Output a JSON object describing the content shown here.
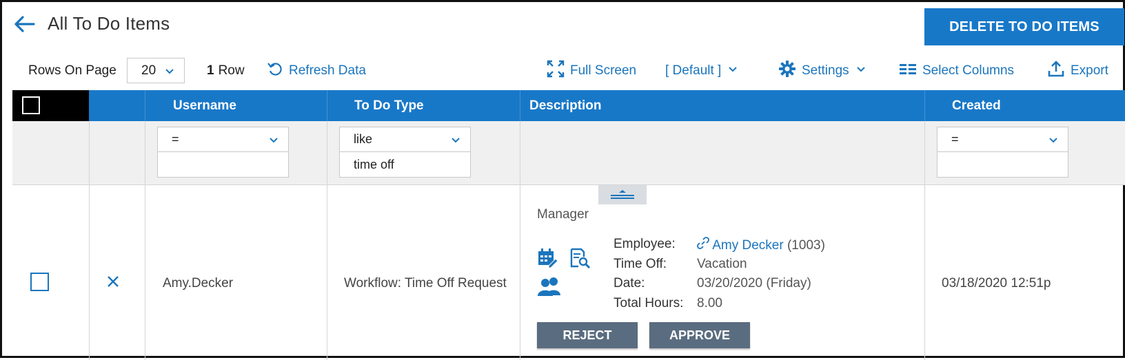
{
  "header": {
    "title": "All To Do Items",
    "delete_button": "DELETE TO DO ITEMS"
  },
  "toolbar": {
    "rows_on_page_label": "Rows On Page",
    "rows_on_page_value": "20",
    "row_count": "1",
    "row_count_label": "Row",
    "refresh_label": "Refresh Data",
    "full_screen_label": "Full Screen",
    "view_label": "[ Default ]",
    "settings_label": "Settings",
    "select_columns_label": "Select Columns",
    "export_label": "Export"
  },
  "table": {
    "columns": {
      "username": "Username",
      "todo_type": "To Do Type",
      "description": "Description",
      "created": "Created"
    },
    "filters": {
      "username_operator": "=",
      "username_value": "",
      "todo_type_operator": "like",
      "todo_type_value": "time off",
      "created_operator": "=",
      "created_value": ""
    },
    "rows": [
      {
        "username": "Amy.Decker",
        "todo_type": "Workflow: Time Off Request",
        "description": {
          "role": "Manager",
          "employee_label": "Employee:",
          "employee_name": "Amy Decker",
          "employee_id": "(1003)",
          "time_off_label": "Time Off:",
          "time_off_value": "Vacation",
          "date_label": "Date:",
          "date_value": "03/20/2020 (Friday)",
          "total_hours_label": "Total Hours:",
          "total_hours_value": "8.00",
          "reject_label": "REJECT",
          "approve_label": "APPROVE"
        },
        "created": "03/18/2020 12:51p"
      }
    ]
  },
  "colors": {
    "accent": "#1878c8",
    "link": "#1b75bc",
    "button_gray": "#5a6c7f"
  },
  "icons": [
    "arrow-left-icon",
    "chevron-down-icon",
    "refresh-icon",
    "fullscreen-icon",
    "gear-icon",
    "columns-icon",
    "export-icon",
    "close-icon",
    "collapse-icon",
    "calendar-edit-icon",
    "document-search-icon",
    "people-icon",
    "link-icon"
  ]
}
